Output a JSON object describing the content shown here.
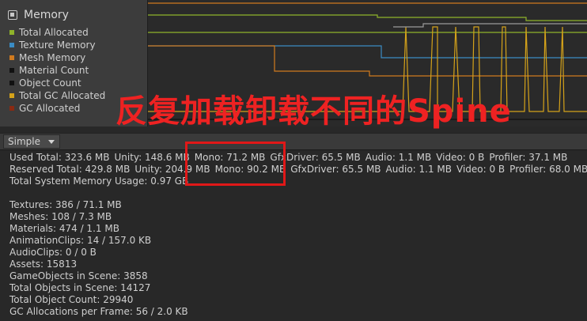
{
  "legend": {
    "title": "Memory",
    "items": [
      {
        "label": "Total Allocated",
        "color": "#8fb32a"
      },
      {
        "label": "Texture Memory",
        "color": "#3a8cc4"
      },
      {
        "label": "Mesh Memory",
        "color": "#d07a1e"
      },
      {
        "label": "Material Count",
        "color": "#111111"
      },
      {
        "label": "Object Count",
        "color": "#111111"
      },
      {
        "label": "Total GC Allocated",
        "color": "#d4a21a"
      },
      {
        "label": "GC Allocated",
        "color": "#8a2a12"
      }
    ]
  },
  "overlay": {
    "text": "反复加载卸载不同的Spine",
    "color": "#ee2222"
  },
  "toolbar": {
    "mode": "Simple"
  },
  "stats": {
    "used": [
      "Used Total: 323.6 MB",
      "Unity: 148.6 MB",
      "Mono: 71.2 MB",
      "GfxDriver: 65.5 MB",
      "Audio: 1.1 MB",
      "Video: 0 B",
      "Profiler: 37.1 MB"
    ],
    "reserved": [
      "Reserved Total: 429.8 MB",
      "Unity: 204.9 MB",
      "Mono: 90.2 MB",
      "GfxDriver: 65.5 MB",
      "Audio: 1.1 MB",
      "Video: 0 B",
      "Profiler: 68.0 MB"
    ],
    "system": "Total System Memory Usage: 0.97 GB",
    "assets": [
      "Textures: 386 / 71.1 MB",
      "Meshes: 108 / 7.3 MB",
      "Materials: 474 / 1.1 MB",
      "AnimationClips: 14 / 157.0 KB",
      "AudioClips: 0 / 0 B",
      "Assets: 15813",
      "GameObjects in Scene: 3858",
      "Total Objects in Scene: 14127",
      "Total Object Count: 29940",
      "GC Allocations per Frame: 56 / 2.0 KB"
    ]
  },
  "highlight_color": "#e01818"
}
